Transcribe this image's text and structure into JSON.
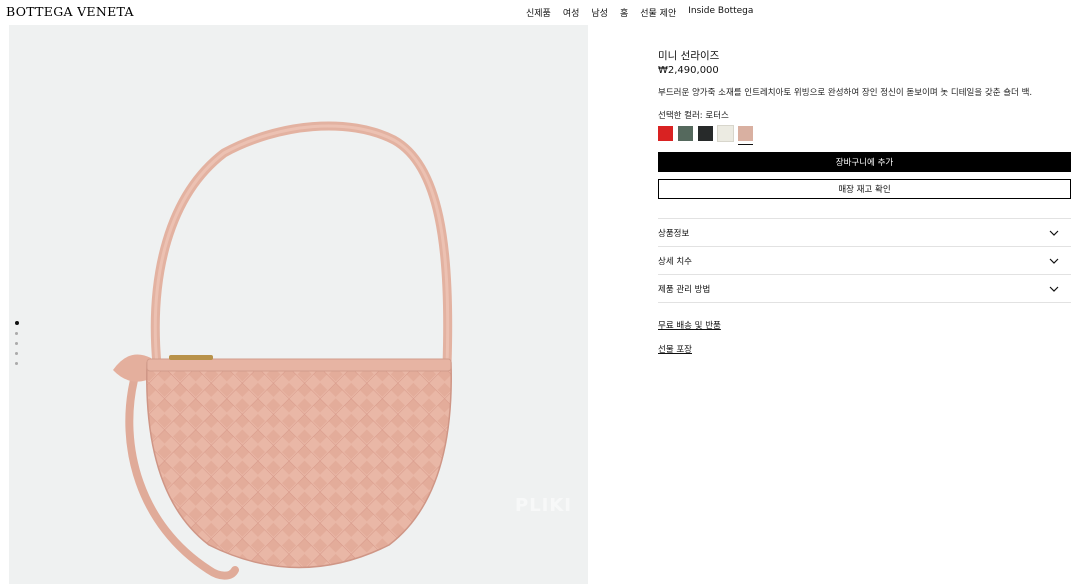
{
  "header": {
    "logo": "BOTTEGA VENETA",
    "nav": [
      "신제품",
      "여성",
      "남성",
      "홈",
      "선물 제안",
      "Inside Bottega"
    ]
  },
  "gallery": {
    "watermark": "PLIKI",
    "dot_count": 5,
    "active_dot": 0,
    "bag_color": "#e9b7a6"
  },
  "product": {
    "title": "미니 선라이즈",
    "price": "₩2,490,000",
    "description": "부드러운 양가죽 소재를 인트레치아토 위빙으로 완성하여 장인 정신이 돋보이며 놋 디테일을 갖춘 숄더 백.",
    "color_label": "선택한 컬러: 로터스",
    "swatches": [
      {
        "name": "red",
        "color": "#d92222"
      },
      {
        "name": "green",
        "color": "#55695d"
      },
      {
        "name": "black",
        "color": "#272a2a"
      },
      {
        "name": "cream",
        "color": "#ecebe2"
      },
      {
        "name": "lotus",
        "color": "#d9b0a1"
      }
    ],
    "selected_swatch": 4,
    "add_to_cart": "장바구니에 추가",
    "check_stock": "매장 재고 확인",
    "accordion": [
      "상품정보",
      "상세 치수",
      "제품 관리 방법"
    ],
    "links": [
      "무료 배송 및 반품",
      "선물 포장"
    ]
  },
  "colors": {
    "accent": "#000000",
    "image_bg": "#eff1f1"
  }
}
